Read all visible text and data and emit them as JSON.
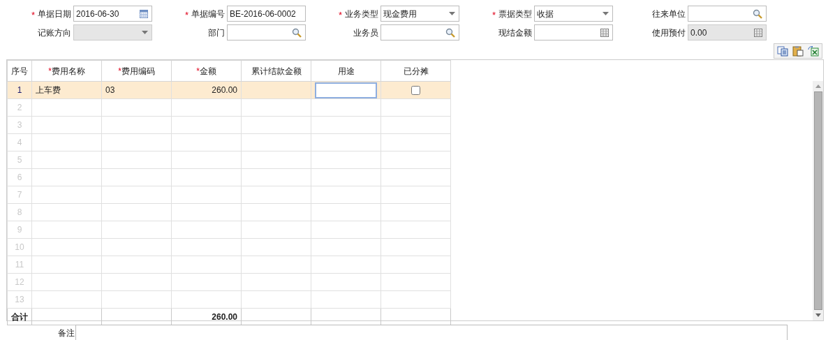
{
  "form": {
    "rows": [
      [
        {
          "label": "单据日期",
          "required_mark": "*",
          "kind": "date",
          "value": "2016-06-30",
          "disabled": false
        },
        {
          "label": "单据编号",
          "required_mark": "*",
          "kind": "text",
          "value": "BE-2016-06-0002",
          "disabled": false
        },
        {
          "label": "业务类型",
          "required_mark": "*",
          "kind": "select",
          "value": "现金费用",
          "disabled": false
        },
        {
          "label": "票据类型",
          "required_mark": "*",
          "kind": "select",
          "value": "收据",
          "disabled": false
        },
        {
          "label": "往来单位",
          "kind": "lookup",
          "disabled": false
        }
      ],
      [
        {
          "label": "记账方向",
          "kind": "select",
          "disabled": true
        },
        {
          "label": "部门",
          "kind": "lookup",
          "disabled": false
        },
        {
          "label": "业务员",
          "kind": "lookup",
          "disabled": false
        },
        {
          "label": "现结金额",
          "kind": "number",
          "disabled": false
        },
        {
          "label": "使用预付",
          "kind": "number",
          "value": "0.00",
          "disabled": true
        }
      ]
    ]
  },
  "grid": {
    "columns": [
      {
        "label": "序号"
      },
      {
        "label": "费用名称",
        "required_mark": "*"
      },
      {
        "label": "费用编码",
        "required_mark": "*"
      },
      {
        "label": "金额",
        "required_mark": "*"
      },
      {
        "label": "累计结款金额"
      },
      {
        "label": "用途"
      },
      {
        "label": "已分摊"
      }
    ],
    "rows": [
      {
        "no": "1",
        "selected": true,
        "name": "上车费",
        "code": "03",
        "amount": "260.00",
        "editing": true,
        "allocated": false
      },
      {
        "no": "2",
        "selected": false
      },
      {
        "no": "3",
        "selected": false
      },
      {
        "no": "4",
        "selected": false
      },
      {
        "no": "5",
        "selected": false
      },
      {
        "no": "6",
        "selected": false
      },
      {
        "no": "7",
        "selected": false
      },
      {
        "no": "8",
        "selected": false
      },
      {
        "no": "9",
        "selected": false
      },
      {
        "no": "10",
        "selected": false
      },
      {
        "no": "11",
        "selected": false
      },
      {
        "no": "12",
        "selected": false
      },
      {
        "no": "13",
        "selected": false
      }
    ],
    "total": {
      "label": "合计",
      "amount": "260.00"
    }
  },
  "remark": {
    "label": "备注"
  }
}
